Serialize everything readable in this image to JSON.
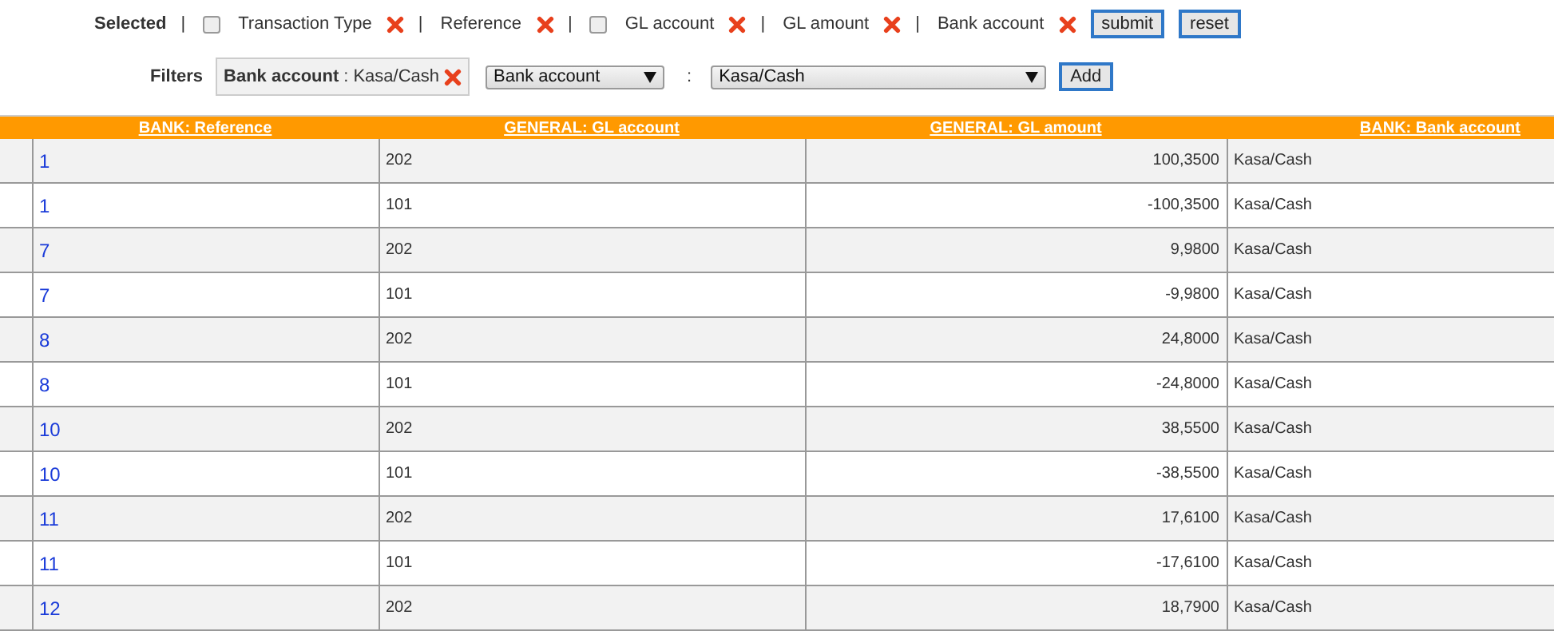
{
  "selected": {
    "label": "Selected",
    "items": [
      {
        "separator": "|",
        "kind": "checkbox",
        "checked": false,
        "label": "Transaction Type"
      },
      {
        "separator": "|",
        "kind": "plain",
        "label": "Reference"
      },
      {
        "separator": "|",
        "kind": "checkbox",
        "checked": false,
        "label": "GL account"
      },
      {
        "separator": "|",
        "kind": "plain",
        "label": "GL amount"
      },
      {
        "separator": "|",
        "kind": "plain",
        "label": "Bank account"
      }
    ],
    "buttons": [
      "submit",
      "reset"
    ]
  },
  "filters": {
    "label": "Filters",
    "active": [
      {
        "name": "Bank account",
        "separator": ":",
        "value": "Kasa/Cash"
      }
    ],
    "field_select": "Bank account",
    "separator": ":",
    "value_select": "Kasa/Cash",
    "add_button": "Add"
  },
  "table": {
    "columns": [
      "BANK: Reference",
      "GENERAL: GL account",
      "GENERAL: GL amount",
      "BANK: Bank account"
    ],
    "rows": [
      [
        "1",
        "202",
        "100,3500",
        "Kasa/Cash"
      ],
      [
        "1",
        "101",
        "-100,3500",
        "Kasa/Cash"
      ],
      [
        "7",
        "202",
        "9,9800",
        "Kasa/Cash"
      ],
      [
        "7",
        "101",
        "-9,9800",
        "Kasa/Cash"
      ],
      [
        "8",
        "202",
        "24,8000",
        "Kasa/Cash"
      ],
      [
        "8",
        "101",
        "-24,8000",
        "Kasa/Cash"
      ],
      [
        "10",
        "202",
        "38,5500",
        "Kasa/Cash"
      ],
      [
        "10",
        "101",
        "-38,5500",
        "Kasa/Cash"
      ],
      [
        "11",
        "202",
        "17,6100",
        "Kasa/Cash"
      ],
      [
        "11",
        "101",
        "-17,6100",
        "Kasa/Cash"
      ],
      [
        "12",
        "202",
        "18,7900",
        "Kasa/Cash"
      ]
    ]
  }
}
